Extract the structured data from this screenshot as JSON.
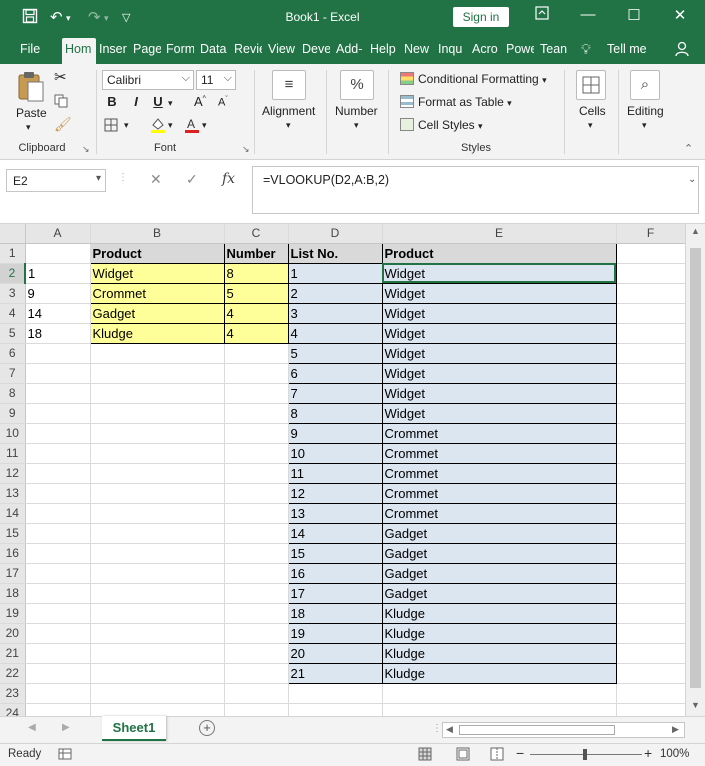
{
  "window": {
    "title": "Book1  -  Excel",
    "sign_in": "Sign in",
    "minimize": "—",
    "restore": "☐",
    "close": "✕"
  },
  "tabs": [
    "File",
    "Hom",
    "Inser",
    "Page",
    "Form",
    "Data",
    "Revie",
    "View",
    "Deve",
    "Add-",
    "Help",
    "New",
    "Inqu",
    "Acro",
    "Powe",
    "Tean"
  ],
  "tell_me": "Tell me",
  "ribbon": {
    "clipboard": {
      "paste": "Paste",
      "label": "Clipboard"
    },
    "font": {
      "name": "Calibri",
      "size": "11",
      "label": "Font",
      "bold": "B",
      "italic": "I",
      "underline": "U"
    },
    "alignment": {
      "label": "Alignment"
    },
    "number": {
      "label": "Number",
      "icon": "%"
    },
    "styles": {
      "conditional": "Conditional Formatting",
      "format_table": "Format as Table",
      "cell_styles": "Cell Styles",
      "label": "Styles"
    },
    "cells": {
      "label": "Cells"
    },
    "editing": {
      "label": "Editing"
    }
  },
  "formula_bar": {
    "name_box": "E2",
    "cancel": "✕",
    "enter": "✓",
    "fx": "fx",
    "formula": "=VLOOKUP(D2,A:B,2)"
  },
  "grid": {
    "columns": [
      "A",
      "B",
      "C",
      "D",
      "E",
      "F"
    ],
    "rows": [
      {
        "n": "1",
        "A": "",
        "B": "Product",
        "C": "Number",
        "D": "List No.",
        "E": "Product"
      },
      {
        "n": "2",
        "A": "1",
        "B": "Widget",
        "C": "8",
        "D": "1",
        "E": "Widget"
      },
      {
        "n": "3",
        "A": "9",
        "B": "Crommet",
        "C": "5",
        "D": "2",
        "E": "Widget"
      },
      {
        "n": "4",
        "A": "14",
        "B": "Gadget",
        "C": "4",
        "D": "3",
        "E": "Widget"
      },
      {
        "n": "5",
        "A": "18",
        "B": "Kludge",
        "C": "4",
        "D": "4",
        "E": "Widget"
      },
      {
        "n": "6",
        "A": "",
        "B": "",
        "C": "",
        "D": "5",
        "E": "Widget"
      },
      {
        "n": "7",
        "A": "",
        "B": "",
        "C": "",
        "D": "6",
        "E": "Widget"
      },
      {
        "n": "8",
        "A": "",
        "B": "",
        "C": "",
        "D": "7",
        "E": "Widget"
      },
      {
        "n": "9",
        "A": "",
        "B": "",
        "C": "",
        "D": "8",
        "E": "Widget"
      },
      {
        "n": "10",
        "A": "",
        "B": "",
        "C": "",
        "D": "9",
        "E": "Crommet"
      },
      {
        "n": "11",
        "A": "",
        "B": "",
        "C": "",
        "D": "10",
        "E": "Crommet"
      },
      {
        "n": "12",
        "A": "",
        "B": "",
        "C": "",
        "D": "11",
        "E": "Crommet"
      },
      {
        "n": "13",
        "A": "",
        "B": "",
        "C": "",
        "D": "12",
        "E": "Crommet"
      },
      {
        "n": "14",
        "A": "",
        "B": "",
        "C": "",
        "D": "13",
        "E": "Crommet"
      },
      {
        "n": "15",
        "A": "",
        "B": "",
        "C": "",
        "D": "14",
        "E": "Gadget"
      },
      {
        "n": "16",
        "A": "",
        "B": "",
        "C": "",
        "D": "15",
        "E": "Gadget"
      },
      {
        "n": "17",
        "A": "",
        "B": "",
        "C": "",
        "D": "16",
        "E": "Gadget"
      },
      {
        "n": "18",
        "A": "",
        "B": "",
        "C": "",
        "D": "17",
        "E": "Gadget"
      },
      {
        "n": "19",
        "A": "",
        "B": "",
        "C": "",
        "D": "18",
        "E": "Kludge"
      },
      {
        "n": "20",
        "A": "",
        "B": "",
        "C": "",
        "D": "19",
        "E": "Kludge"
      },
      {
        "n": "21",
        "A": "",
        "B": "",
        "C": "",
        "D": "20",
        "E": "Kludge"
      },
      {
        "n": "22",
        "A": "",
        "B": "",
        "C": "",
        "D": "21",
        "E": "Kludge"
      },
      {
        "n": "23",
        "A": "",
        "B": "",
        "C": "",
        "D": "",
        "E": ""
      },
      {
        "n": "24",
        "A": "",
        "B": "",
        "C": "",
        "D": "",
        "E": ""
      }
    ],
    "selected_cell": "E2"
  },
  "sheets": {
    "active": "Sheet1",
    "add": "+"
  },
  "status": {
    "ready": "Ready",
    "zoom": "100%"
  },
  "colors": {
    "accent": "#217346",
    "yellow_fill": "#ffff99",
    "blue_fill": "#dce6f1"
  }
}
